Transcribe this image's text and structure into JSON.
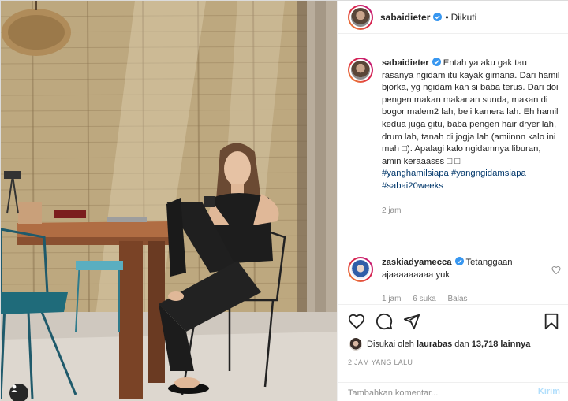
{
  "post": {
    "username": "sabaidieter",
    "follow_dot": "•",
    "follow_status": "Diikuti"
  },
  "caption": {
    "username": "sabaidieter",
    "text": " Entah ya aku gak tau rasanya ngidam itu kayak gimana. Dari hamil bjorka, yg ngidam kan si baba terus. Dari doi pengen makan makanan sunda, makan di bogor malem2 lah, beli kamera lah. Eh hamil kedua juga gitu, baba pengen hair dryer lah, drum lah, tanah di jogja lah (amiinnn kalo ini mah □). Apalagi kalo ngidamnya liburan, amin keraaasss □ □",
    "hashtags": [
      "#yanghamilsiapa",
      "#yangngidamsiapa",
      "#sabai20weeks"
    ],
    "time": "2 jam"
  },
  "comment": {
    "username": "zaskiadyamecca",
    "text": " Tetanggaan ajaaaaaaaaa yuk",
    "time": "1 jam",
    "likes": "6 suka",
    "reply": "Balas"
  },
  "actions": {
    "liked_by_prefix": "Disukai oleh",
    "liked_by_user": "laurabas",
    "liked_by_and": "dan",
    "liked_by_count": "13,718 lainnya",
    "date": "2 JAM YANG LALU"
  },
  "add_comment": {
    "placeholder": "Tambahkan komentar...",
    "post_label": "Kirim"
  },
  "icons": {
    "verified": "verified-badge-icon",
    "like": "heart-icon",
    "comment": "comment-icon",
    "share": "paper-plane-icon",
    "save": "bookmark-icon",
    "user_tag": "user-tag-icon"
  },
  "colors": {
    "verified": "#3897f0",
    "hashtag": "#00376b",
    "muted": "#8e8e8e",
    "post_button_disabled": "#b2dffc"
  }
}
